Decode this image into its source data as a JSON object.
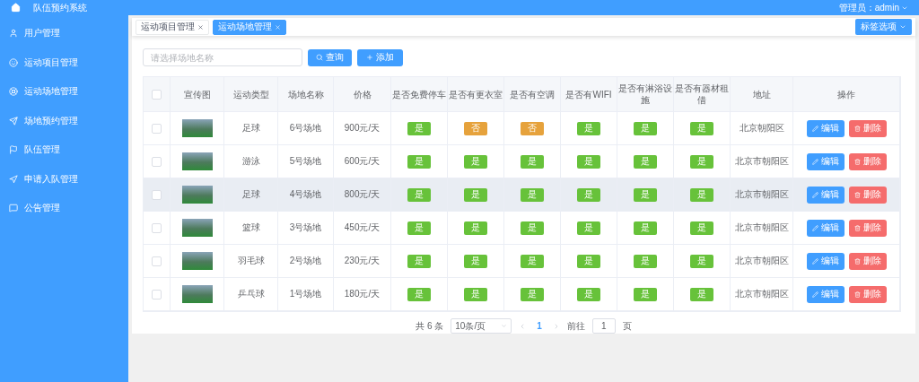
{
  "header": {
    "title": "队伍预约系统",
    "user": "管理员：admin"
  },
  "sidebar": {
    "items": [
      {
        "label": "用户管理"
      },
      {
        "label": "运动项目管理"
      },
      {
        "label": "运动场地管理"
      },
      {
        "label": "场地预约管理"
      },
      {
        "label": "队伍管理"
      },
      {
        "label": "申请入队管理"
      },
      {
        "label": "公告管理"
      }
    ]
  },
  "tabs": [
    {
      "label": "运动项目管理",
      "selected": false
    },
    {
      "label": "运动场地管理",
      "selected": true
    }
  ],
  "tab_options": "标签选项",
  "search": {
    "placeholder": "请选择场地名称",
    "query_button": "查询",
    "add_button": "添加"
  },
  "table": {
    "header_checked": false,
    "columns": [
      "宣传图",
      "运动类型",
      "场地名称",
      "价格",
      "是否免费停车",
      "是否有更衣室",
      "是否有空调",
      "是否有WIFI",
      "是否有淋浴设施",
      "是否有器材租借",
      "地址",
      "操作"
    ],
    "rows": [
      {
        "checked": false,
        "highlighted": false,
        "sport": "足球",
        "venue": "6号场地",
        "price": "900元/天",
        "flags": [
          {
            "text": "是",
            "kind": "yes"
          },
          {
            "text": "否",
            "kind": "no"
          },
          {
            "text": "否",
            "kind": "no"
          },
          {
            "text": "是",
            "kind": "yes"
          },
          {
            "text": "是",
            "kind": "yes"
          },
          {
            "text": "是",
            "kind": "yes"
          }
        ],
        "address": "北京朝阳区",
        "edit": "编辑",
        "delete": "删除"
      },
      {
        "checked": false,
        "highlighted": false,
        "sport": "游泳",
        "venue": "5号场地",
        "price": "600元/天",
        "flags": [
          {
            "text": "是",
            "kind": "yes"
          },
          {
            "text": "是",
            "kind": "yes"
          },
          {
            "text": "是",
            "kind": "yes"
          },
          {
            "text": "是",
            "kind": "yes"
          },
          {
            "text": "是",
            "kind": "yes"
          },
          {
            "text": "是",
            "kind": "yes"
          }
        ],
        "address": "北京市朝阳区",
        "edit": "编辑",
        "delete": "删除"
      },
      {
        "checked": false,
        "highlighted": true,
        "sport": "足球",
        "venue": "4号场地",
        "price": "800元/天",
        "flags": [
          {
            "text": "是",
            "kind": "yes"
          },
          {
            "text": "是",
            "kind": "yes"
          },
          {
            "text": "是",
            "kind": "yes"
          },
          {
            "text": "是",
            "kind": "yes"
          },
          {
            "text": "是",
            "kind": "yes"
          },
          {
            "text": "是",
            "kind": "yes"
          }
        ],
        "address": "北京市朝阳区",
        "edit": "编辑",
        "delete": "删除"
      },
      {
        "checked": false,
        "highlighted": false,
        "sport": "篮球",
        "venue": "3号场地",
        "price": "450元/天",
        "flags": [
          {
            "text": "是",
            "kind": "yes"
          },
          {
            "text": "是",
            "kind": "yes"
          },
          {
            "text": "是",
            "kind": "yes"
          },
          {
            "text": "是",
            "kind": "yes"
          },
          {
            "text": "是",
            "kind": "yes"
          },
          {
            "text": "是",
            "kind": "yes"
          }
        ],
        "address": "北京市朝阳区",
        "edit": "编辑",
        "delete": "删除"
      },
      {
        "checked": false,
        "highlighted": false,
        "sport": "羽毛球",
        "venue": "2号场地",
        "price": "230元/天",
        "flags": [
          {
            "text": "是",
            "kind": "yes"
          },
          {
            "text": "是",
            "kind": "yes"
          },
          {
            "text": "是",
            "kind": "yes"
          },
          {
            "text": "是",
            "kind": "yes"
          },
          {
            "text": "是",
            "kind": "yes"
          },
          {
            "text": "是",
            "kind": "yes"
          }
        ],
        "address": "北京市朝阳区",
        "edit": "编辑",
        "delete": "删除"
      },
      {
        "checked": false,
        "highlighted": false,
        "sport": "乒乓球",
        "venue": "1号场地",
        "price": "180元/天",
        "flags": [
          {
            "text": "是",
            "kind": "yes"
          },
          {
            "text": "是",
            "kind": "yes"
          },
          {
            "text": "是",
            "kind": "yes"
          },
          {
            "text": "是",
            "kind": "yes"
          },
          {
            "text": "是",
            "kind": "yes"
          },
          {
            "text": "是",
            "kind": "yes"
          }
        ],
        "address": "北京市朝阳区",
        "edit": "编辑",
        "delete": "删除"
      }
    ]
  },
  "pagination": {
    "total": "共 6 条",
    "page_size": "10条/页",
    "pages": [
      {
        "label": "1",
        "selected": true
      }
    ],
    "goto_label": "前往",
    "goto_value": "1",
    "goto_suffix": "页"
  }
}
